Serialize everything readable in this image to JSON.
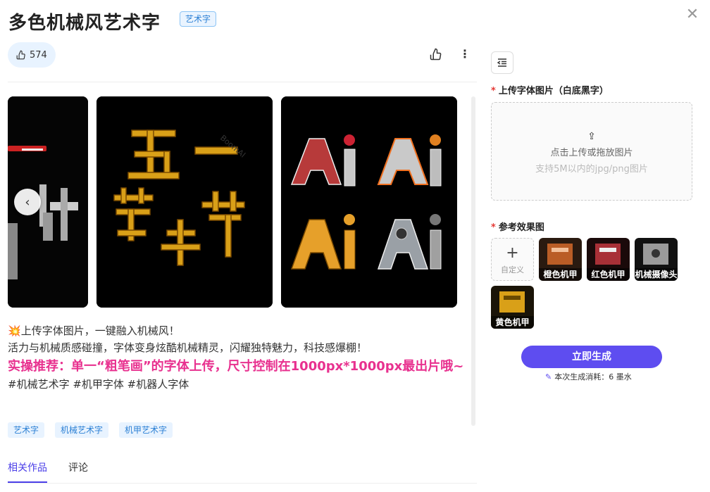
{
  "header": {
    "title": "多色机械风艺术字",
    "badge": "艺术字",
    "close_icon": "close-icon"
  },
  "actions": {
    "like_count": "574",
    "like_icon": "thumbs-up-icon",
    "more_icon": "more-vertical-icon"
  },
  "carousel": {
    "watermark": "BoomAI",
    "cards": [
      {
        "chars_top": [
          "五",
          "一"
        ],
        "chars_bottom": [
          "劳",
          "动",
          "节"
        ],
        "style": "gold-mechanical"
      },
      {
        "text": "Ai",
        "variants": [
          "red",
          "silver",
          "yellow",
          "silver-orange"
        ]
      }
    ]
  },
  "description": {
    "line1": "上传字体图片，一键融入机械风！",
    "line2": "活力与机械质感碰撞，字体变身炫酷机械精灵，闪耀独特魅力，科技感爆棚！",
    "highlight": "实操推荐：单一“粗笔画”的字体上传，尺寸控制在1000px*1000px最出片哦~",
    "hashtags": "#机械艺术字 #机甲字体 #机器人字体"
  },
  "tags": [
    "艺术字",
    "机械艺术字",
    "机甲艺术字"
  ],
  "tabs": [
    "相关作品",
    "评论"
  ],
  "panel": {
    "upload_label": "上传字体图片（白底黑字）",
    "upload_main": "点击上传或拖放图片",
    "upload_sub": "支持5M以内的jpg/png图片",
    "effects_label": "参考效果图",
    "custom_label": "自定义",
    "effects": [
      "橙色机甲",
      "红色机甲",
      "机械摄像头",
      "黄色机甲"
    ],
    "generate_label": "立即生成",
    "cost_text": "本次生成消耗：6 墨水"
  },
  "colors": {
    "accent": "#5e4df0",
    "highlight": "#e8318f",
    "tag_bg": "#e8f3ff",
    "tag_text": "#2a7fd4"
  }
}
